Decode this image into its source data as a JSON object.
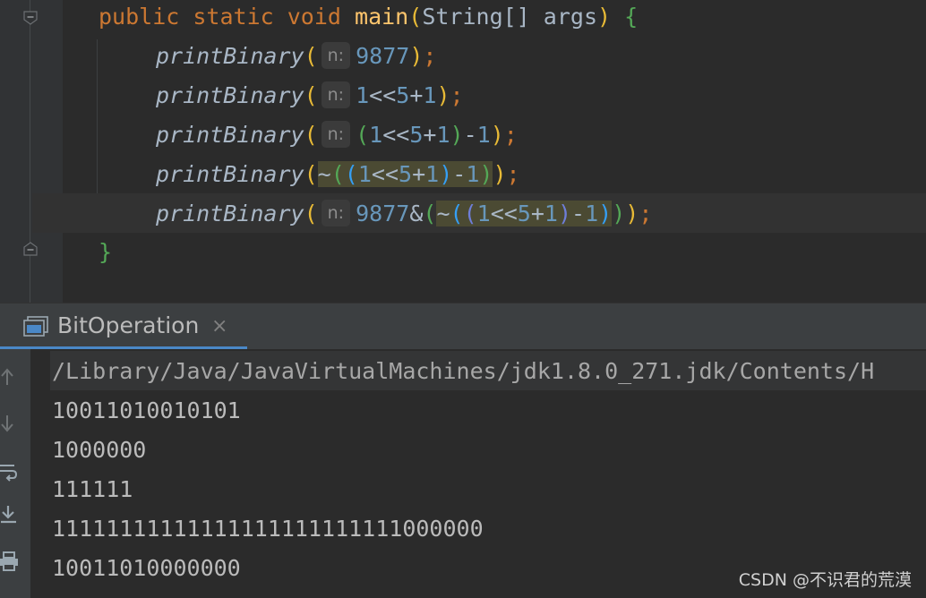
{
  "editor": {
    "line_main": {
      "kw_public": "public",
      "kw_static": "static",
      "kw_void": "void",
      "fn_name": "main",
      "params_open": "(",
      "type": "String[]",
      "arg": "args",
      "params_close": ")",
      "brace": "{"
    },
    "call_name": "printBinary",
    "param_hint": "n:",
    "lines": [
      {
        "arg": "9877"
      },
      {
        "arg": "1<<5+1"
      },
      {
        "arg": "(1<<5+1)-1"
      },
      {
        "arg": "~((1<<5+1)-1)"
      },
      {
        "arg": "9877&(~((1<<5+1)-1))"
      }
    ],
    "closing_brace": "}"
  },
  "tool_window": {
    "tab_label": "BitOperation",
    "close_glyph": "×",
    "side_icons": [
      "up-arrow-icon",
      "down-arrow-icon",
      "soft-wrap-icon",
      "scroll-to-end-icon",
      "print-icon"
    ]
  },
  "console": {
    "command": "/Library/Java/JavaVirtualMachines/jdk1.8.0_271.jdk/Contents/H",
    "outputs": [
      "10011010010101",
      "1000000",
      "111111",
      "11111111111111111111111111000000",
      "10011010000000"
    ]
  },
  "watermark": "CSDN @不识君的荒漠",
  "colors": {
    "keyword": "#cc7832",
    "function": "#ffc66d",
    "number": "#6897bb",
    "accent": "#4a88c7"
  }
}
